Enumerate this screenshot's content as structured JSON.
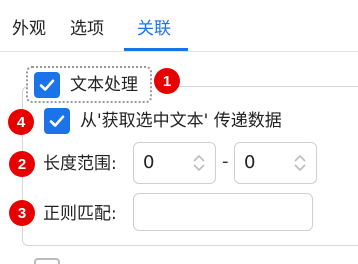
{
  "tabs": [
    {
      "label": "外观"
    },
    {
      "label": "选项"
    },
    {
      "label": "关联",
      "active": true
    }
  ],
  "text_processing": {
    "label": "文本处理",
    "checked": true,
    "badge": "1"
  },
  "fetch_selected": {
    "label": "从'获取选中文本' 传递数据",
    "checked": true,
    "badge": "4"
  },
  "length_range": {
    "label": "长度范围:",
    "min_value": "0",
    "separator": "-",
    "max_value": "0",
    "badge": "2"
  },
  "regex_match": {
    "label": "正则匹配:",
    "value": "",
    "badge": "3"
  },
  "colors": {
    "accent": "#1a73e8",
    "badge": "#e60000"
  }
}
